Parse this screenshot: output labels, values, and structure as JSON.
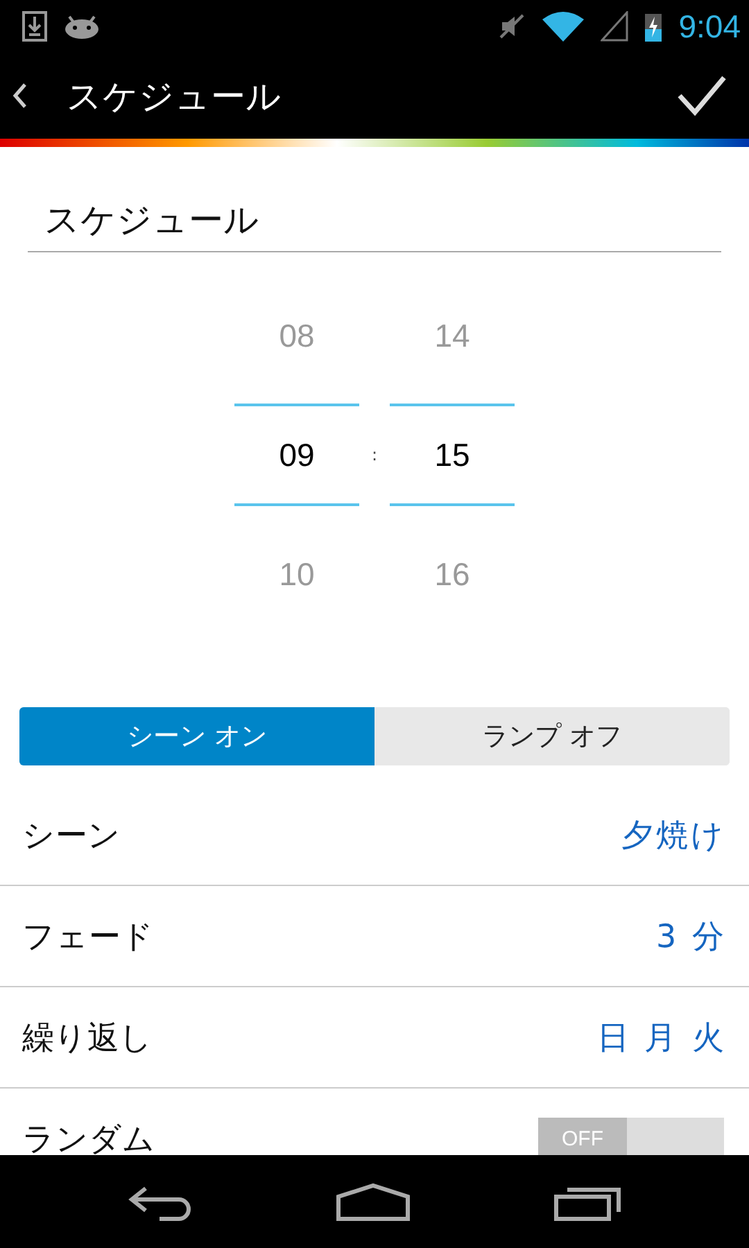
{
  "status_bar": {
    "time": "9:04"
  },
  "action_bar": {
    "title": "スケジュール"
  },
  "name_field": {
    "value": "スケジュール"
  },
  "time_picker": {
    "separator": ":",
    "columns": [
      {
        "items": [
          {
            "label": "08",
            "selected": false
          },
          {
            "label": "09",
            "selected": true
          },
          {
            "label": "10",
            "selected": false
          }
        ]
      },
      {
        "items": [
          {
            "label": "14",
            "selected": false
          },
          {
            "label": "15",
            "selected": true
          },
          {
            "label": "16",
            "selected": false
          }
        ]
      }
    ]
  },
  "mode_toggle": [
    {
      "label": "シーン オン",
      "selected": true
    },
    {
      "label": "ランプ オフ",
      "selected": false
    }
  ],
  "settings": [
    {
      "kind": "value",
      "label": "シーン",
      "value": "夕焼け"
    },
    {
      "kind": "value",
      "label": "フェード",
      "value": "3 分"
    },
    {
      "kind": "value",
      "label": "繰り返し",
      "value": "日 月 火"
    },
    {
      "kind": "switch",
      "label": "ランダム",
      "switch_label": "OFF",
      "on": false
    }
  ]
}
